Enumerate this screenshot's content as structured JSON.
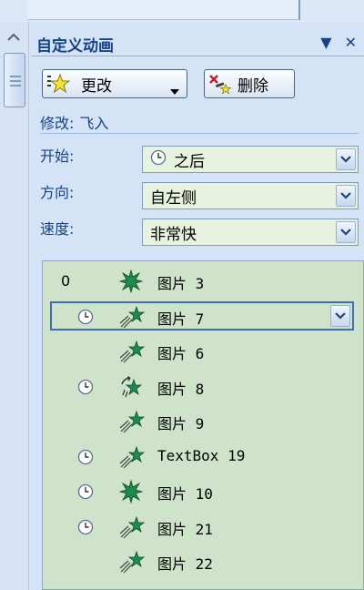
{
  "panel": {
    "title": "自定义动画",
    "menu_glyph": "▼",
    "close_glyph": "✕"
  },
  "toolbar": {
    "change_label": "更改",
    "delete_label": "删除"
  },
  "modify": {
    "prefix": "修改:",
    "effect": "飞入"
  },
  "properties": {
    "start": {
      "label": "开始:",
      "value": "之后",
      "icon": "clock-icon"
    },
    "direction": {
      "label": "方向:",
      "value": "自左侧"
    },
    "speed": {
      "label": "速度:",
      "value": "非常快"
    }
  },
  "list": {
    "items": [
      {
        "num": "0",
        "clock": false,
        "star": "burst",
        "name": "图片 3",
        "selected": false
      },
      {
        "num": "",
        "clock": true,
        "star": "fly",
        "name": "图片 7",
        "selected": true
      },
      {
        "num": "",
        "clock": false,
        "star": "fly",
        "name": "图片 6",
        "selected": false
      },
      {
        "num": "",
        "clock": true,
        "star": "spin",
        "name": "图片 8",
        "selected": false
      },
      {
        "num": "",
        "clock": false,
        "star": "fly",
        "name": "图片 9",
        "selected": false
      },
      {
        "num": "",
        "clock": true,
        "star": "fly",
        "name": "TextBox 19",
        "selected": false
      },
      {
        "num": "",
        "clock": true,
        "star": "burst",
        "name": "图片 10",
        "selected": false
      },
      {
        "num": "",
        "clock": true,
        "star": "fly",
        "name": "图片 21",
        "selected": false
      },
      {
        "num": "",
        "clock": false,
        "star": "fly",
        "name": "图片 22",
        "selected": false
      }
    ]
  },
  "colors": {
    "panel_bg": "#d4e4f6",
    "select_bg": "#e8f3df",
    "list_bg": "#cfe3cb",
    "label_blue": "#15428b",
    "star_green": "#1f8a4c",
    "selection_border": "#3f6bbf"
  }
}
